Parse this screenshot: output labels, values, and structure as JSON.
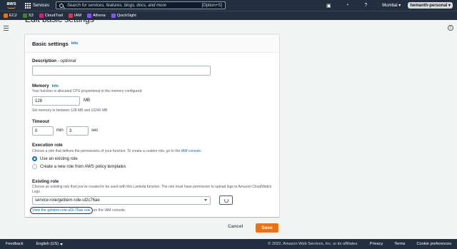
{
  "topnav": {
    "logo": "aws",
    "services_label": "Services",
    "search_placeholder": "Search for services, features, blogs, docs, and more",
    "search_shortcut": "[Option+S]",
    "region": "Mumbai ▾",
    "user": "hemanth-personal ▾",
    "icons": [
      "terminal-icon",
      "bell-icon",
      "help-icon"
    ]
  },
  "favorites": [
    {
      "label": "EC2",
      "color": "#ec7211"
    },
    {
      "label": "S3",
      "color": "#3f8624"
    },
    {
      "label": "CloudTrail",
      "color": "#e7157b"
    },
    {
      "label": "IAM",
      "color": "#dd344c"
    },
    {
      "label": "Athena",
      "color": "#8c4fff"
    },
    {
      "label": "QuickSight",
      "color": "#8c4fff"
    }
  ],
  "page_title": "Edit basic settings",
  "card": {
    "title": "Basic settings",
    "info": "Info",
    "description": {
      "label": "Description",
      "optional": " - optional",
      "value": ""
    },
    "memory": {
      "label": "Memory",
      "info": "Info",
      "desc": "Your function is allocated CPU proportional to the memory configured.",
      "value": "128",
      "unit": "MB",
      "hint": "Set memory to between 128 MB and 10240 MB"
    },
    "timeout": {
      "label": "Timeout",
      "min_value": "0",
      "min_unit": "min",
      "sec_value": "3",
      "sec_unit": "sec"
    },
    "execution_role": {
      "label": "Execution role",
      "desc_prefix": "Choose a role that defines the permissions of your function. To create a custom role, go to the ",
      "desc_link": "IAM console",
      "desc_suffix": ".",
      "options": [
        "Use an existing role",
        "Create a new role from AWS policy templates"
      ],
      "selected": "Use an existing role"
    },
    "existing_role": {
      "label": "Existing role",
      "desc": "Choose an existing role that you've created to be used with this Lambda function. The role must have permission to upload logs to Amazon CloudWatch Logs.",
      "value": "service-role/getitem-role-ul2c76ae",
      "view_link": "View the getitem-role-ul2c76ae role",
      "view_suffix": " on the IAM console."
    }
  },
  "actions": {
    "cancel": "Cancel",
    "save": "Save"
  },
  "footer": {
    "feedback": "Feedback",
    "language": "English (US)",
    "copyright": "© 2022, Amazon Web Services, Inc. or its affiliates.",
    "links": [
      "Privacy",
      "Terms",
      "Cookie preferences"
    ]
  }
}
